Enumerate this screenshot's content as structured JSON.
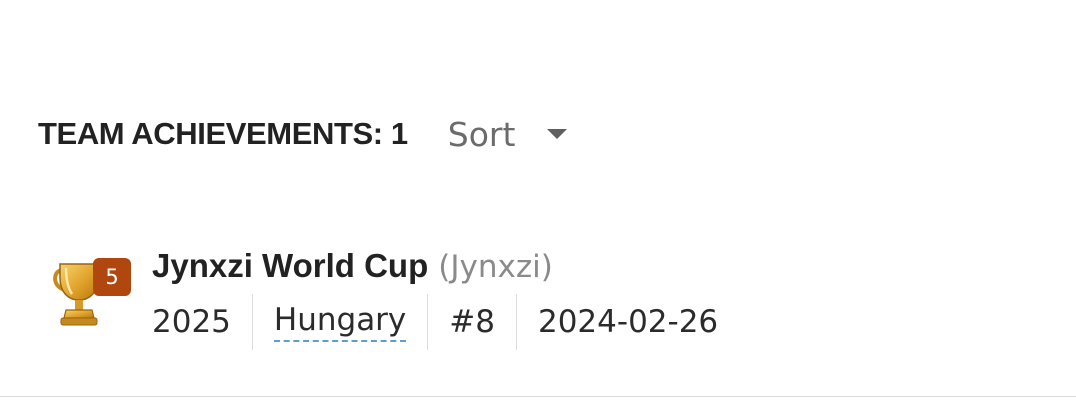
{
  "section": {
    "title": "TEAM ACHIEVEMENTS: 1",
    "sort_label": "Sort",
    "sort_icon": "caret-down-icon"
  },
  "achievements": [
    {
      "icon": "trophy-icon",
      "badge": "5",
      "name": "Jynxzi World Cup",
      "organizer": "(Jynxzi)",
      "year": "2025",
      "country": "Hungary",
      "rank": "#8",
      "date": "2024-02-26"
    }
  ],
  "colors": {
    "badge": "#b0470f",
    "link_underline": "#5aa0c8",
    "trophy_gold": "#e0a22a"
  }
}
